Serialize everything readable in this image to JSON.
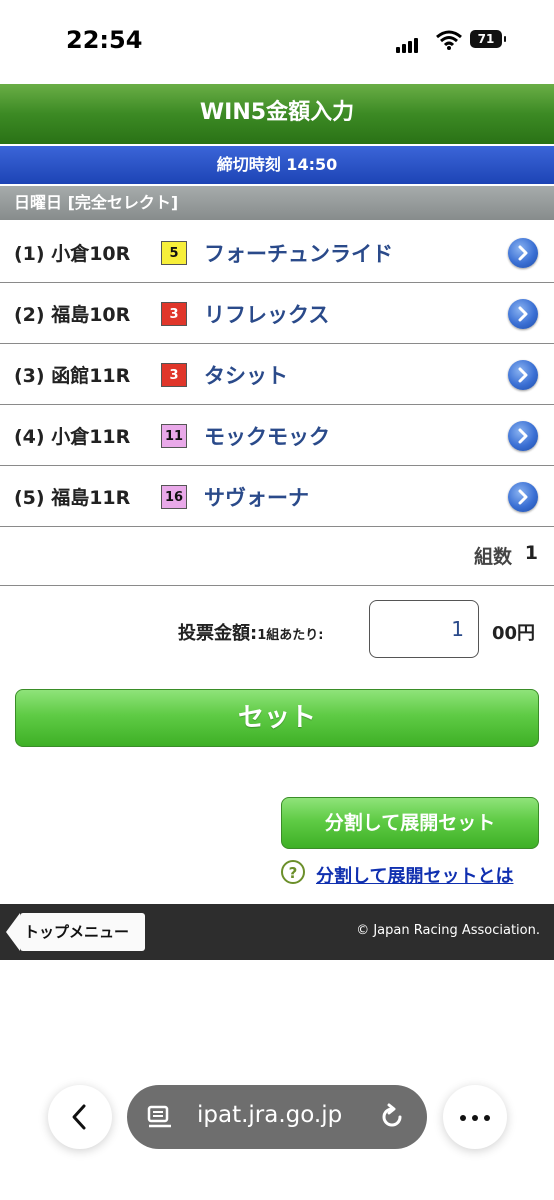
{
  "status_bar": {
    "time": "22:54",
    "battery": "71"
  },
  "header": {
    "title": "WIN5金額入力"
  },
  "deadline": {
    "text": "締切時刻 14:50"
  },
  "day": {
    "text": "日曜日 [完全セレクト]"
  },
  "races": [
    {
      "race": "(1) 小倉10R",
      "number": "5",
      "number_color": "#f7ef3a",
      "number_text_color": "#111111",
      "horse": "フォーチュンライド"
    },
    {
      "race": "(2) 福島10R",
      "number": "3",
      "number_color": "#e0362a",
      "number_text_color": "#ffffff",
      "horse": "リフレックス"
    },
    {
      "race": "(3) 函館11R",
      "number": "3",
      "number_color": "#e0362a",
      "number_text_color": "#ffffff",
      "horse": "タシット"
    },
    {
      "race": "(4) 小倉11R",
      "number": "11",
      "number_color": "#e9a9e9",
      "number_text_color": "#111111",
      "horse": "モックモック"
    },
    {
      "race": "(5) 福島11R",
      "number": "16",
      "number_color": "#e9a9e9",
      "number_text_color": "#111111",
      "horse": "サヴォーナ"
    }
  ],
  "combination": {
    "label": "組数",
    "value": "1"
  },
  "amount": {
    "label": "投票金額:",
    "sublabel": "1組あたり:",
    "value": "1",
    "unit": "00円"
  },
  "buttons": {
    "set": "セット",
    "split_set": "分割して展開セット"
  },
  "help": {
    "icon_text": "?",
    "link": "分割して展開セットとは"
  },
  "footer": {
    "top_menu": "トップメニュー",
    "copyright": "© Japan Racing Association."
  },
  "browser": {
    "url": "ipat.jra.go.jp"
  },
  "colors": {
    "header_green": "#3c8a24",
    "deadline_blue": "#1d44b5",
    "button_green": "#5fcb45",
    "horse_text": "#2a4a8a"
  }
}
